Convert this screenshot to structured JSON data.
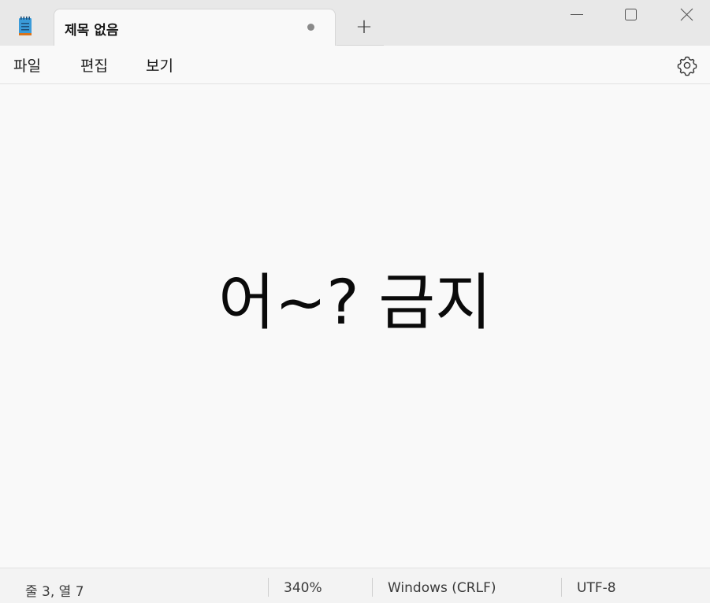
{
  "titlebar": {
    "app_icon": "notepad-icon",
    "tab_title": "제목 없음",
    "new_tab_label": "+",
    "minimize_icon": "minimize-icon",
    "maximize_icon": "maximize-icon",
    "close_icon": "close-icon"
  },
  "menu": {
    "file": "파일",
    "edit": "편집",
    "view": "보기",
    "settings_icon": "gear-icon"
  },
  "editor": {
    "content": "어~? 금지"
  },
  "status": {
    "position": "줄 3, 열 7",
    "zoom": "340%",
    "line_ending": "Windows (CRLF)",
    "encoding": "UTF-8"
  },
  "colors": {
    "titlebar_bg": "#e8e8e8",
    "editor_bg": "#f9f9f9",
    "icon_blue": "#3a9bd9",
    "icon_orange": "#d9731a"
  }
}
